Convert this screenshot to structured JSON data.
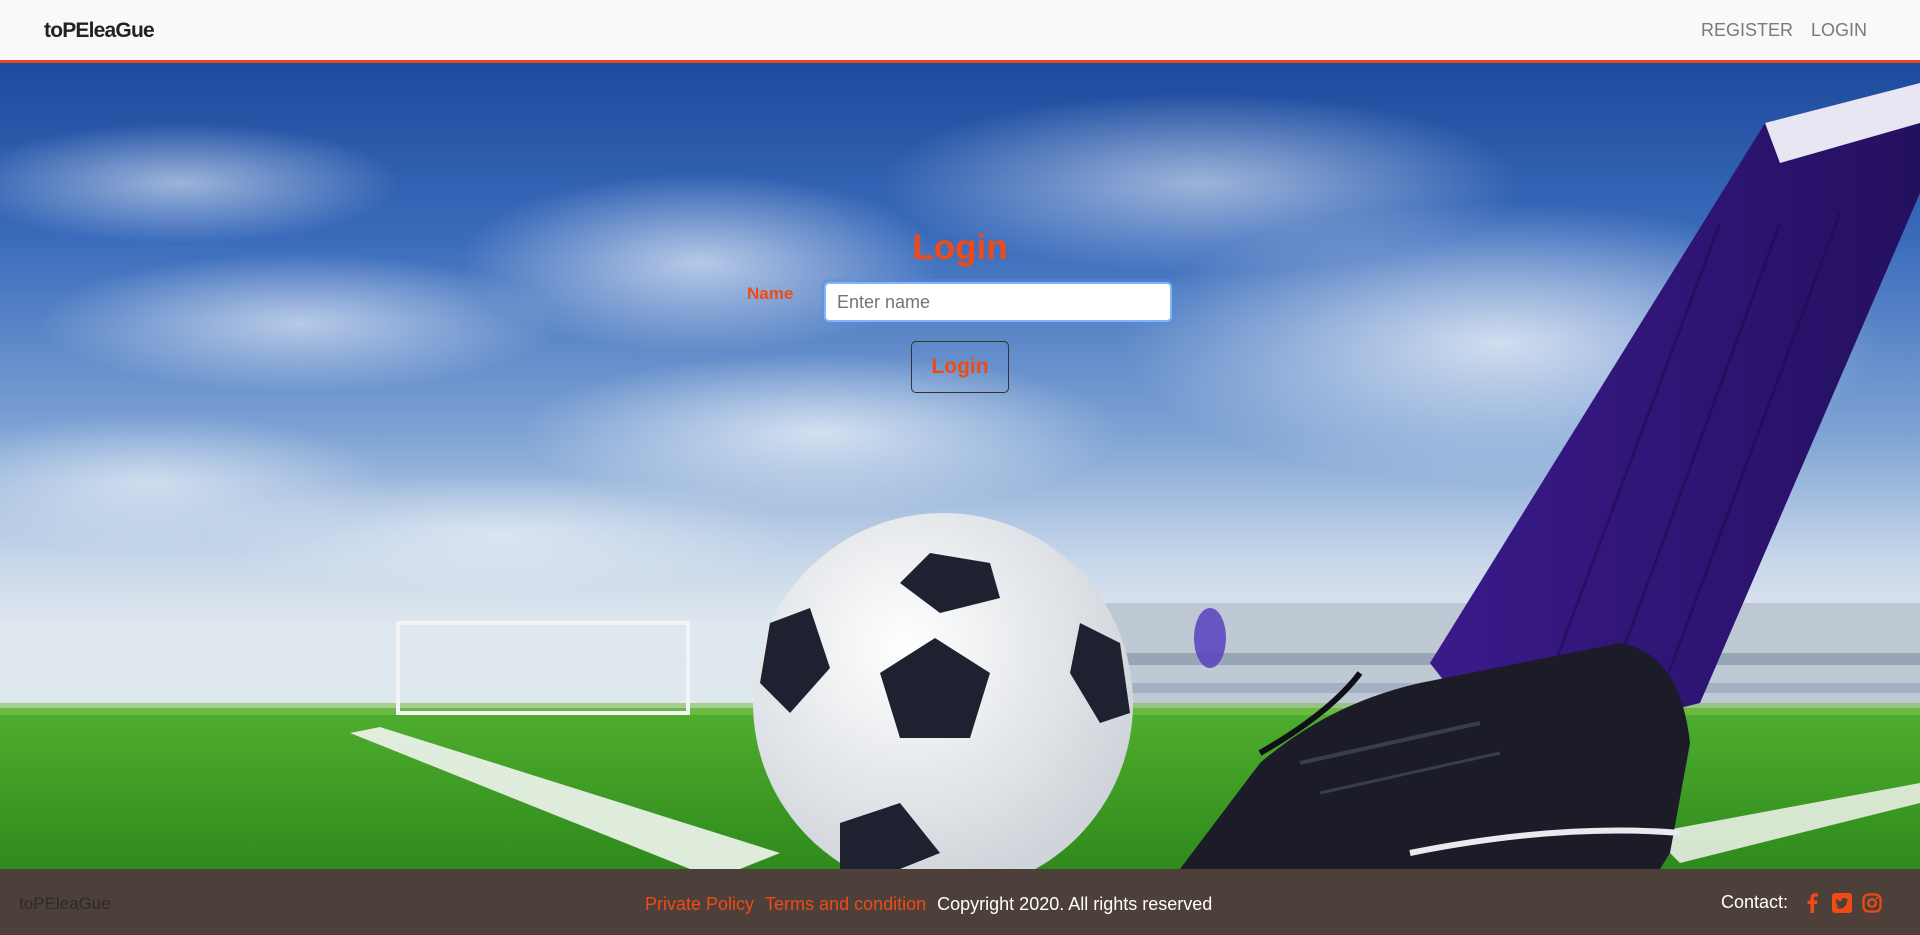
{
  "navbar": {
    "brand": "toPEleaGue",
    "links": [
      {
        "label": "REGISTER"
      },
      {
        "label": "LOGIN"
      }
    ]
  },
  "login": {
    "title": "Login",
    "name_label": "Name",
    "name_placeholder": "Enter name",
    "name_value": "",
    "button_label": "Login"
  },
  "footer": {
    "brand": "toPEleaGue",
    "links": [
      {
        "label": "Private Policy"
      },
      {
        "label": "Terms and condition"
      }
    ],
    "copyright": "Copyright 2020. All rights reserved",
    "contact_label": "Contact:",
    "social_icons": [
      "facebook-icon",
      "twitter-icon",
      "instagram-icon"
    ]
  },
  "colors": {
    "accent": "#f04b14",
    "navbar_bg": "#f8f9fa",
    "footer_bg": "#4d3f3a"
  }
}
